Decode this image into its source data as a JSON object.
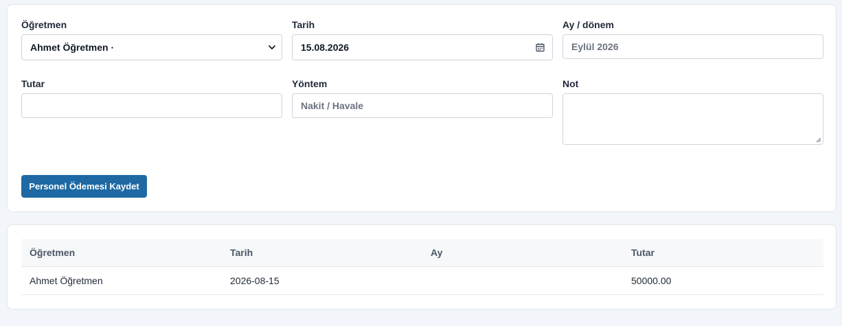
{
  "form": {
    "teacher": {
      "label": "Öğretmen",
      "value": "Ahmet Öğretmen ·"
    },
    "date": {
      "label": "Tarih",
      "value": "15.08.2026"
    },
    "period": {
      "label": "Ay / dönem",
      "placeholder": "Eylül 2026"
    },
    "amount": {
      "label": "Tutar",
      "value": ""
    },
    "method": {
      "label": "Yöntem",
      "placeholder": "Nakit / Havale"
    },
    "note": {
      "label": "Not",
      "value": ""
    },
    "submit_label": "Personel Ödemesi Kaydet"
  },
  "table": {
    "columns": [
      "Öğretmen",
      "Tarih",
      "Ay",
      "Tutar"
    ],
    "rows": [
      [
        "Ahmet Öğretmen",
        "2026-08-15",
        "",
        "50000.00"
      ]
    ]
  },
  "colors": {
    "accent": "#1e69a3",
    "background": "#f2f5f9",
    "card": "#ffffff"
  },
  "icons": {
    "select": "chevron-down-icon",
    "date": "calendar-icon",
    "textarea": "resize-grip-icon"
  }
}
